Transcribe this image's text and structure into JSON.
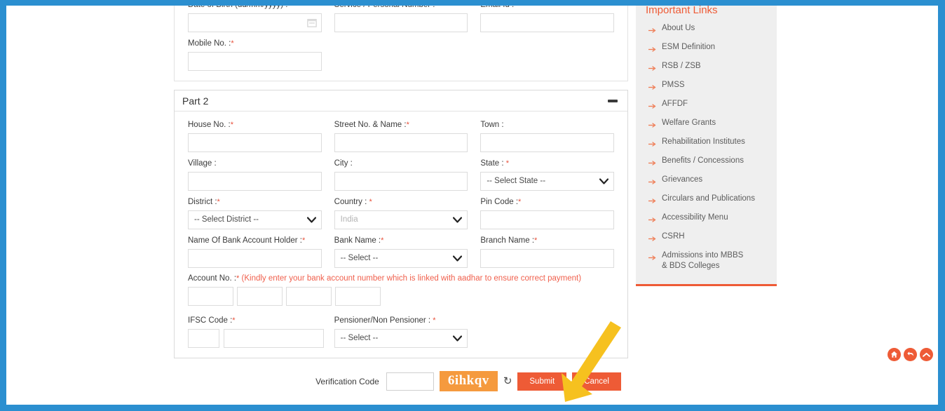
{
  "theme": {
    "frame_blue": "#2b8fd0",
    "accent_orange": "#ee5b36",
    "captcha_orange": "#f59a3e",
    "required_red": "#e8503a",
    "note_red": "#f0604d",
    "sidebar_bg": "#efefef"
  },
  "part1": {
    "fields": {
      "date_of_birth": {
        "label": "Date of Birth (dd/mm/yyyy) :",
        "required": true,
        "value": "",
        "icon": "calendar-icon"
      },
      "service_number": {
        "label": "Service / Personal Number :",
        "required": true,
        "value": ""
      },
      "email_id": {
        "label": "Email Id :",
        "required": false,
        "value": ""
      },
      "mobile_no": {
        "label": "Mobile No. :",
        "required": true,
        "value": ""
      }
    }
  },
  "part2": {
    "title": "Part 2",
    "collapse_icon": "minus-icon",
    "rows": [
      [
        {
          "name": "house-no",
          "label": "House No. :",
          "required": true,
          "type": "text",
          "value": ""
        },
        {
          "name": "street-no-name",
          "label": "Street No. & Name :",
          "required": true,
          "type": "text",
          "value": ""
        },
        {
          "name": "town",
          "label": "Town :",
          "required": false,
          "type": "text",
          "value": ""
        }
      ],
      [
        {
          "name": "village",
          "label": "Village :",
          "required": false,
          "type": "text",
          "value": ""
        },
        {
          "name": "city",
          "label": "City :",
          "required": false,
          "type": "text",
          "value": ""
        },
        {
          "name": "state",
          "label": "State : ",
          "required": true,
          "type": "select",
          "value": "-- Select State --"
        }
      ],
      [
        {
          "name": "district",
          "label": "District :",
          "required": true,
          "type": "select",
          "value": "-- Select District --"
        },
        {
          "name": "country",
          "label": "Country : ",
          "required": true,
          "type": "select",
          "value": "India",
          "disabled": true
        },
        {
          "name": "pin-code",
          "label": "Pin Code :",
          "required": true,
          "type": "text",
          "value": ""
        }
      ],
      [
        {
          "name": "bank-account-holder-name",
          "label": "Name Of Bank Account Holder :",
          "required": true,
          "type": "text",
          "value": ""
        },
        {
          "name": "bank-name",
          "label": "Bank Name :",
          "required": true,
          "type": "select",
          "value": "-- Select --"
        },
        {
          "name": "branch-name",
          "label": "Branch Name :",
          "required": true,
          "type": "text",
          "value": ""
        }
      ]
    ],
    "account_no": {
      "label": "Account No. :",
      "required": true,
      "note": " (Kindly enter your bank account number which is linked with aadhar to ensure correct payment)",
      "segments": [
        "",
        "",
        "",
        ""
      ]
    },
    "ifsc": {
      "label": "IFSC Code :",
      "required": true,
      "segments": [
        "",
        ""
      ]
    },
    "pensioner": {
      "label": "Pensioner/Non Pensioner : ",
      "required": true,
      "value": "-- Select --"
    }
  },
  "verification": {
    "label": "Verification Code",
    "input_value": "",
    "captcha_text": "6ihkqv",
    "refresh_icon": "refresh-icon",
    "submit_label": "Submit",
    "cancel_label": "Cancel"
  },
  "sidebar": {
    "title": "Important Links",
    "items": [
      {
        "label": "About Us"
      },
      {
        "label": "ESM Definition"
      },
      {
        "label": "RSB / ZSB"
      },
      {
        "label": "PMSS"
      },
      {
        "label": "AFFDF"
      },
      {
        "label": "Welfare Grants"
      },
      {
        "label": "Rehabilitation Institutes"
      },
      {
        "label": "Benefits / Concessions"
      },
      {
        "label": "Grievances"
      },
      {
        "label": "Circulars and Publications"
      },
      {
        "label": "Accessibility Menu"
      },
      {
        "label": "CSRH"
      },
      {
        "label": "Admissions into MBBS & BDS Colleges"
      }
    ]
  },
  "fabs": [
    {
      "name": "home-fab",
      "icon": "home-icon"
    },
    {
      "name": "back-fab",
      "icon": "undo-arrow-icon"
    },
    {
      "name": "scroll-top-fab",
      "icon": "chevron-up-icon"
    }
  ],
  "annotation": {
    "type": "arrow",
    "color": "#f6c11f",
    "points_to": "Submit"
  }
}
